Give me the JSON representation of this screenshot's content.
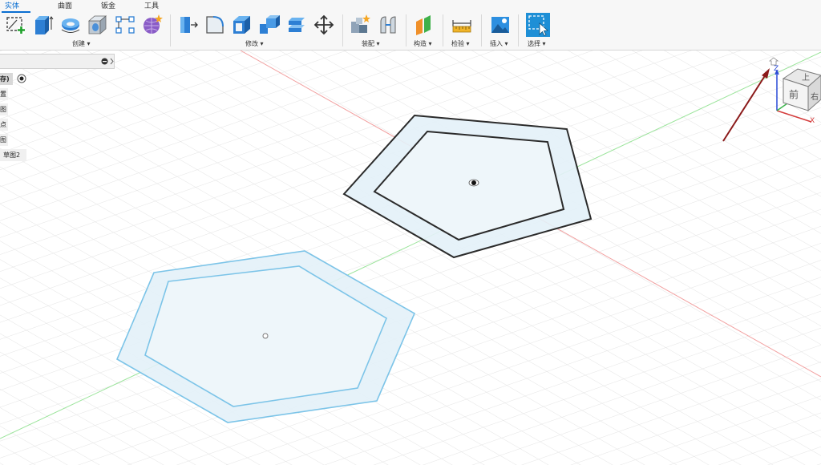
{
  "tabs": [
    {
      "label": "实体",
      "active": true
    },
    {
      "label": "曲面",
      "active": false
    },
    {
      "label": "钣金",
      "active": false
    },
    {
      "label": "工具",
      "active": false
    }
  ],
  "groups": [
    {
      "label": "创建 ▾"
    },
    {
      "label": "修改 ▾"
    },
    {
      "label": "装配 ▾"
    },
    {
      "label": "构造 ▾"
    },
    {
      "label": "检验 ▾"
    },
    {
      "label": "插入 ▾"
    },
    {
      "label": "选择 ▾"
    }
  ],
  "browser": {
    "rows": [
      {
        "label": "存)"
      },
      {
        "label": "置"
      },
      {
        "label": "图"
      },
      {
        "label": "点"
      },
      {
        "label": "图"
      },
      {
        "label": "草图2"
      }
    ]
  },
  "viewcube": {
    "top_face": "上",
    "front_face": "前",
    "right_face": "右",
    "axis_z": "Z",
    "axis_x": "X"
  },
  "colors": {
    "accent": "#0a6ed1",
    "sketch_black": "#2b2b2b",
    "sketch_blue": "#7cc4e8",
    "profile_fill": "#e3f1f8",
    "annotation_arrow": "#8b1a1a"
  }
}
